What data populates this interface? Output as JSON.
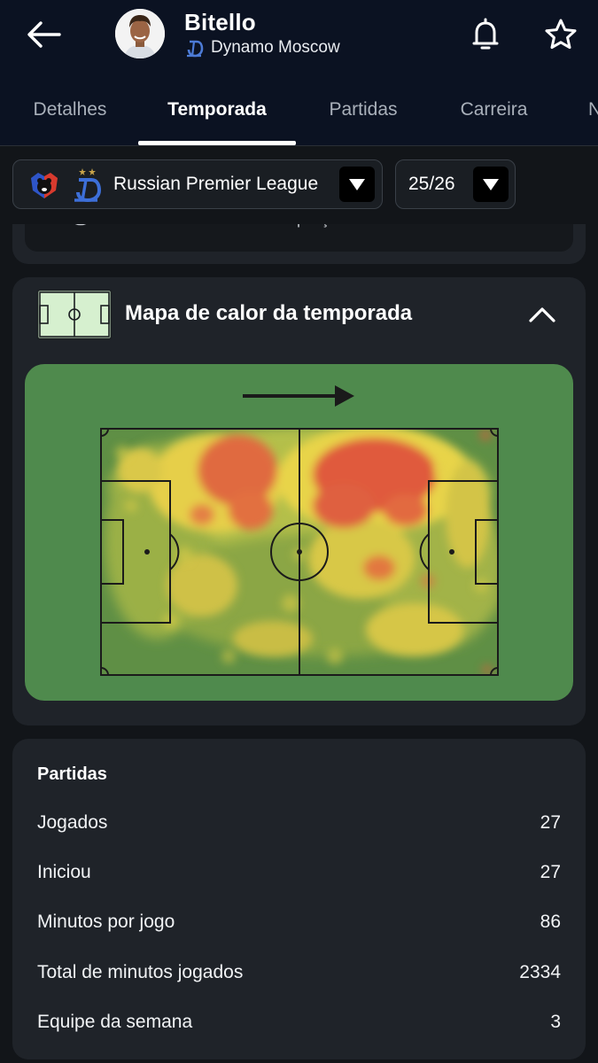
{
  "player": {
    "name": "Bitello",
    "team": "Dynamo Moscow"
  },
  "tabs": [
    {
      "label": "Detalhes"
    },
    {
      "label": "Temporada"
    },
    {
      "label": "Partidas"
    },
    {
      "label": "Carreira"
    },
    {
      "label": "N"
    }
  ],
  "active_tab": "Temporada",
  "filters": {
    "league": "Russian Premier League",
    "season": "25/26"
  },
  "rating_note": "Média da nota durante a competição selecionada.",
  "heatmap": {
    "title": "Mapa de calor da temporada",
    "direction": "attacking right",
    "colors": {
      "pitch": "#4f8a4d",
      "low": "#7fa14a",
      "mid": "#e3d74b",
      "high": "#e0523f"
    }
  },
  "stats": {
    "heading": "Partidas",
    "rows": [
      {
        "label": "Jogados",
        "value": "27"
      },
      {
        "label": "Iniciou",
        "value": "27"
      },
      {
        "label": "Minutos por jogo",
        "value": "86"
      },
      {
        "label": "Total de minutos jogados",
        "value": "2334"
      },
      {
        "label": "Equipe da semana",
        "value": "3"
      }
    ]
  },
  "icons": [
    "back-arrow-icon",
    "bell-icon",
    "star-icon",
    "league-logo-icon",
    "dynamo-logo-icon",
    "chevron-down-icon",
    "pitch-icon",
    "chevron-up-icon",
    "info-icon",
    "direction-arrow-icon"
  ]
}
